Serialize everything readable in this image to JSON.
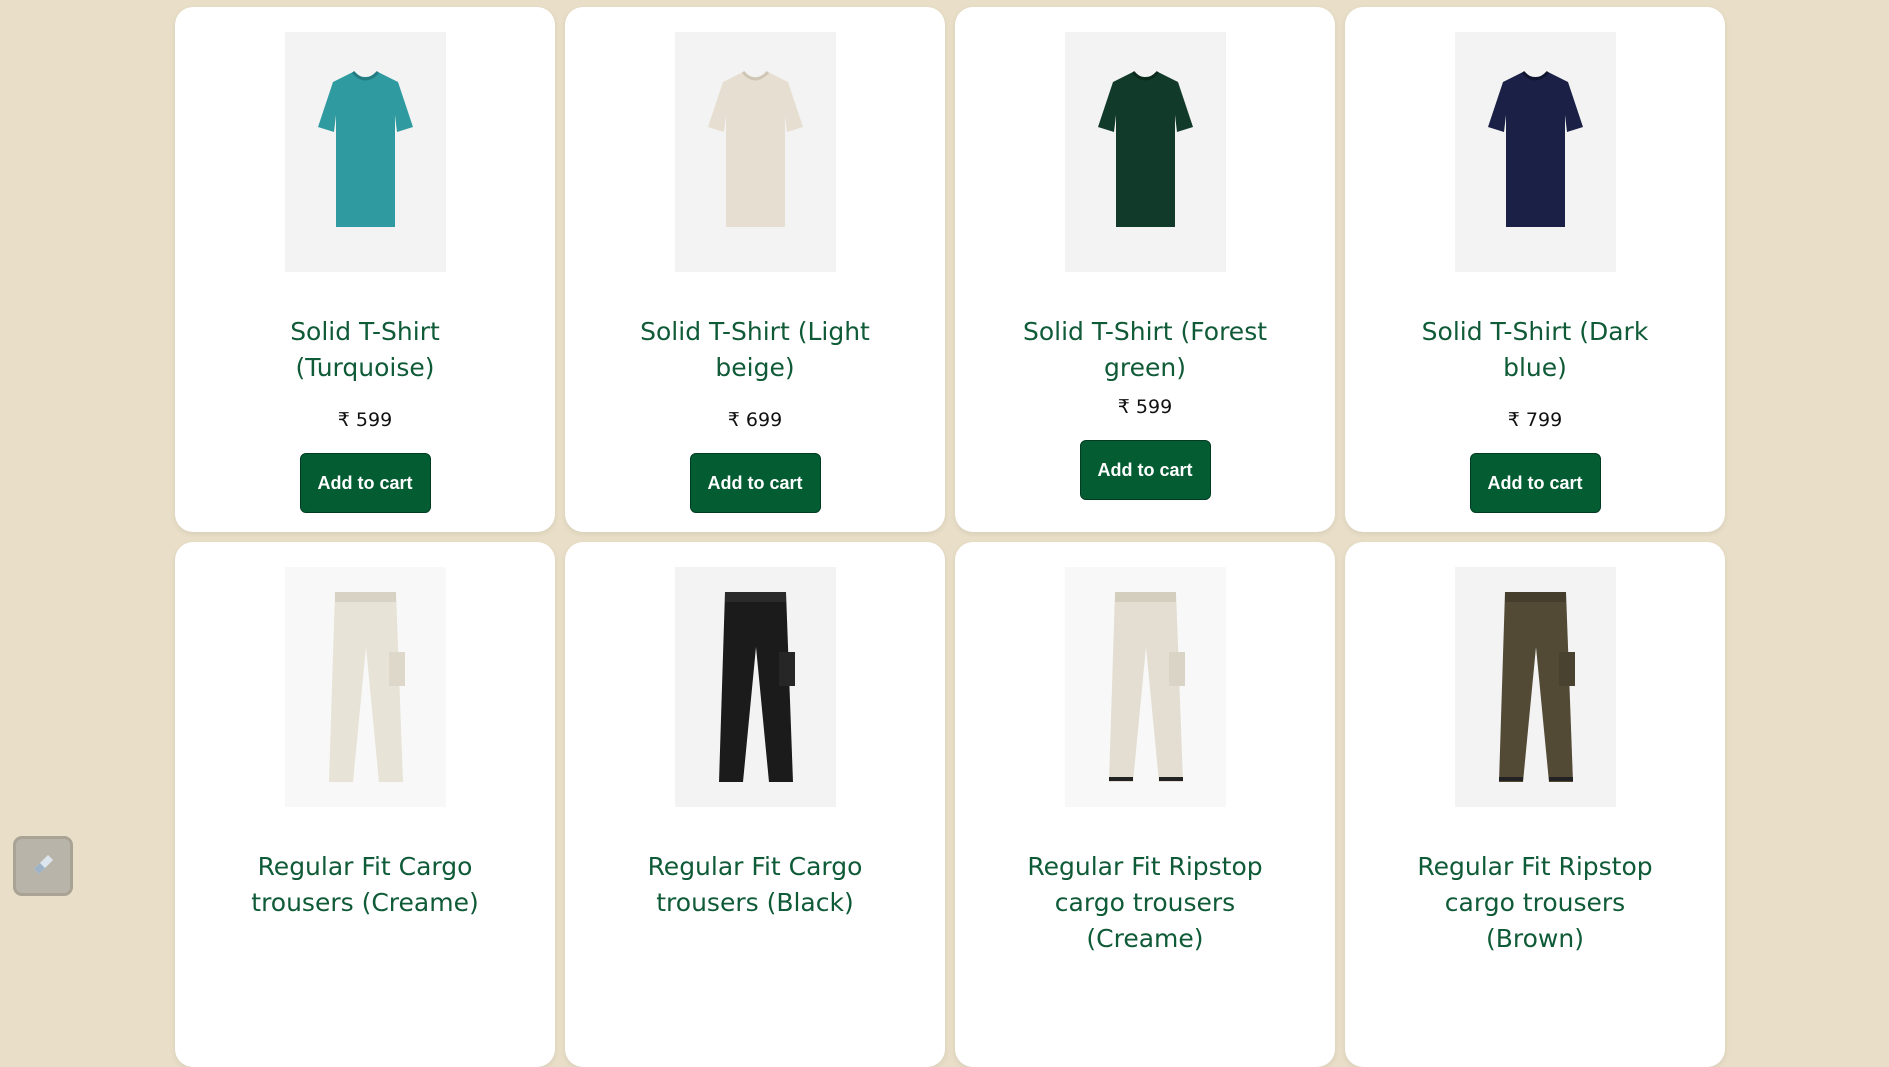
{
  "colors": {
    "background": "#e9dfc8",
    "card": "#ffffff",
    "title": "#0f5a37",
    "button": "#045c33",
    "button_text": "#ffffff"
  },
  "products": [
    {
      "title": "Solid T-Shirt (Turquoise)",
      "price": "₹ 599",
      "button": "Add to cart",
      "image": "tshirt-turquoise",
      "color": "#2f9ba0"
    },
    {
      "title": "Solid T-Shirt (Light beige)",
      "price": "₹ 699",
      "button": "Add to cart",
      "image": "tshirt-light-beige",
      "color": "#e6ded0"
    },
    {
      "title": "Solid T-Shirt (Forest green)",
      "price": "₹ 599",
      "button": "Add to cart",
      "image": "tshirt-forest-green",
      "color": "#123a2a"
    },
    {
      "title": "Solid T-Shirt (Dark blue)",
      "price": "₹ 799",
      "button": "Add to cart",
      "image": "tshirt-dark-blue",
      "color": "#1b2146"
    },
    {
      "title": "Regular Fit Cargo trousers (Creame)",
      "image": "cargo-creame",
      "color": "#e7e3d6"
    },
    {
      "title": "Regular Fit Cargo trousers (Black)",
      "image": "cargo-black",
      "color": "#1b1b1b"
    },
    {
      "title": "Regular Fit Ripstop cargo trousers (Creame)",
      "image": "ripstop-creame",
      "color": "#e3ded1"
    },
    {
      "title": "Regular Fit Ripstop cargo trousers (Brown)",
      "image": "ripstop-brown",
      "color": "#524a35"
    }
  ],
  "widget": {
    "icon": "app-launcher-icon"
  }
}
